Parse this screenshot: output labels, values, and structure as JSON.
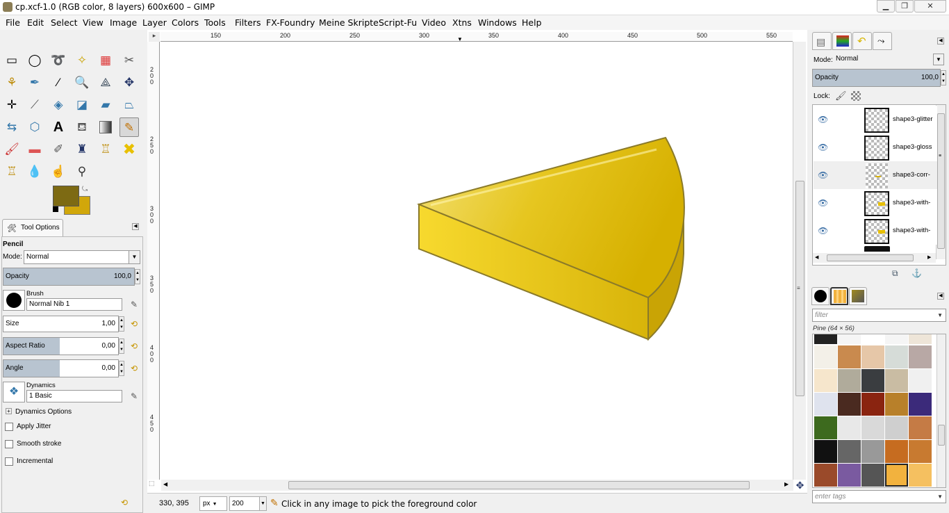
{
  "window": {
    "title": "cp.xcf-1.0 (RGB color, 8 layers) 600x600 – GIMP",
    "minimize": "▁",
    "maximize": "❐",
    "close": "✕"
  },
  "menu": [
    "File",
    "Edit",
    "Select",
    "View",
    "Image",
    "Layer",
    "Colors",
    "Tools",
    "Filters",
    "FX-Foundry",
    "Meine Skripte",
    "Script-Fu",
    "Video",
    "Xtns",
    "Windows",
    "Help"
  ],
  "toolbox": {
    "active_tool": "pencil",
    "colors": {
      "foreground": "#7d6a13",
      "background": "#d1a70a"
    }
  },
  "tool_options": {
    "tab_label": "Tool Options",
    "tool_name": "Pencil",
    "mode_label": "Mode:",
    "mode_value": "Normal",
    "opacity_label": "Opacity",
    "opacity_value": "100,0",
    "brush_label": "Brush",
    "brush_value": "Normal Nib 1",
    "size_label": "Size",
    "size_value": "1,00",
    "aspect_label": "Aspect Ratio",
    "aspect_value": "0,00",
    "angle_label": "Angle",
    "angle_value": "0,00",
    "dynamics_label": "Dynamics",
    "dynamics_value": "1 Basic",
    "dynamics_options": "Dynamics Options",
    "apply_jitter": "Apply Jitter",
    "smooth_stroke": "Smooth stroke",
    "incremental": "Incremental"
  },
  "ruler": {
    "h_labels": [
      "150",
      "200",
      "250",
      "300",
      "350",
      "400",
      "450",
      "500",
      "550"
    ],
    "v_labels": [
      "200",
      "250",
      "300",
      "350",
      "400",
      "450"
    ]
  },
  "status": {
    "coords": "330, 395",
    "unit": "px",
    "zoom": "200",
    "message": "Click in any image to pick the foreground color"
  },
  "layers": {
    "mode_label": "Mode:",
    "mode_value": "Normal",
    "opacity_label": "Opacity",
    "opacity_value": "100,0",
    "lock_label": "Lock:",
    "items": [
      "shape3-glitter",
      "shape3-gloss",
      "shape3-corr-",
      "shape3-with-",
      "shape3-with-"
    ]
  },
  "patterns": {
    "filter_placeholder": "filter",
    "current": "Pine (64 × 56)",
    "tags_placeholder": "enter tags"
  }
}
